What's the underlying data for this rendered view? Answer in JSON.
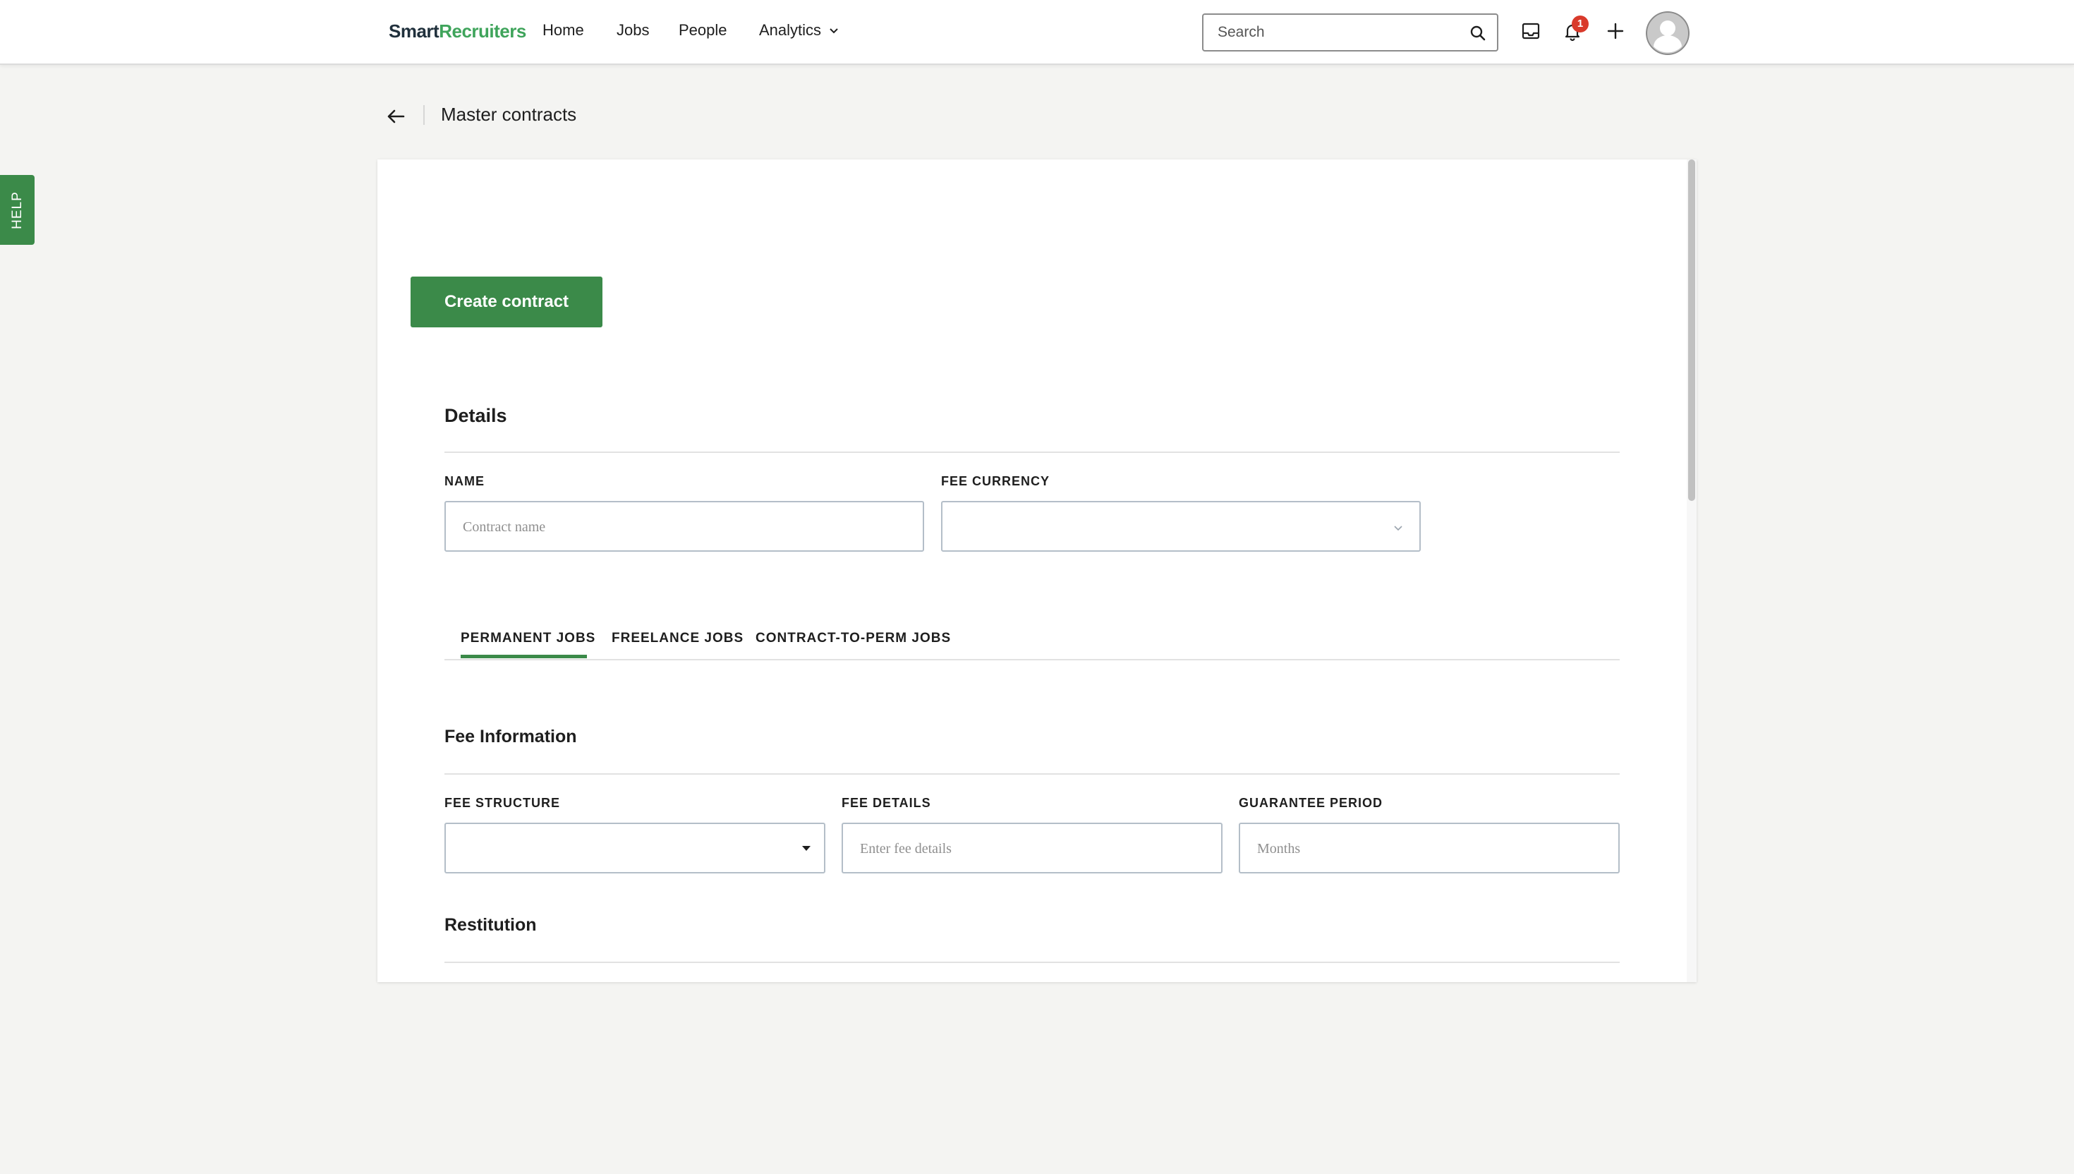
{
  "brand": {
    "part1": "Smart",
    "part2": "Recruiters"
  },
  "nav": {
    "home": "Home",
    "jobs": "Jobs",
    "people": "People",
    "analytics": "Analytics"
  },
  "search": {
    "placeholder": "Search"
  },
  "notifications": {
    "count": "1"
  },
  "help": {
    "label": "HELP"
  },
  "breadcrumb": {
    "title": "Master contracts"
  },
  "actions": {
    "create_label": "Create contract"
  },
  "details": {
    "title": "Details",
    "name_label": "NAME",
    "name_placeholder": "Contract name",
    "currency_label": "FEE CURRENCY",
    "currency_value": ""
  },
  "tabs": [
    {
      "label": "PERMANENT JOBS",
      "active": true
    },
    {
      "label": "FREELANCE JOBS",
      "active": false
    },
    {
      "label": "CONTRACT-TO-PERM JOBS",
      "active": false
    }
  ],
  "fee": {
    "title": "Fee Information",
    "structure_label": "FEE STRUCTURE",
    "structure_value": "",
    "details_label": "FEE DETAILS",
    "details_placeholder": "Enter fee details",
    "guarantee_label": "GUARANTEE PERIOD",
    "guarantee_placeholder": "Months"
  },
  "restitution": {
    "title": "Restitution"
  },
  "colors": {
    "accent": "#3b8a49",
    "brand_green": "#3fa45b",
    "badge_red": "#d93a2b",
    "background": "#f4f4f2"
  },
  "icons": {
    "back": "arrow-left-icon",
    "search": "magnifier-icon",
    "inbox": "inbox-icon",
    "bell": "bell-icon",
    "plus": "plus-icon",
    "avatar": "user-avatar-icon",
    "analytics_chevron": "chevron-down-icon"
  }
}
